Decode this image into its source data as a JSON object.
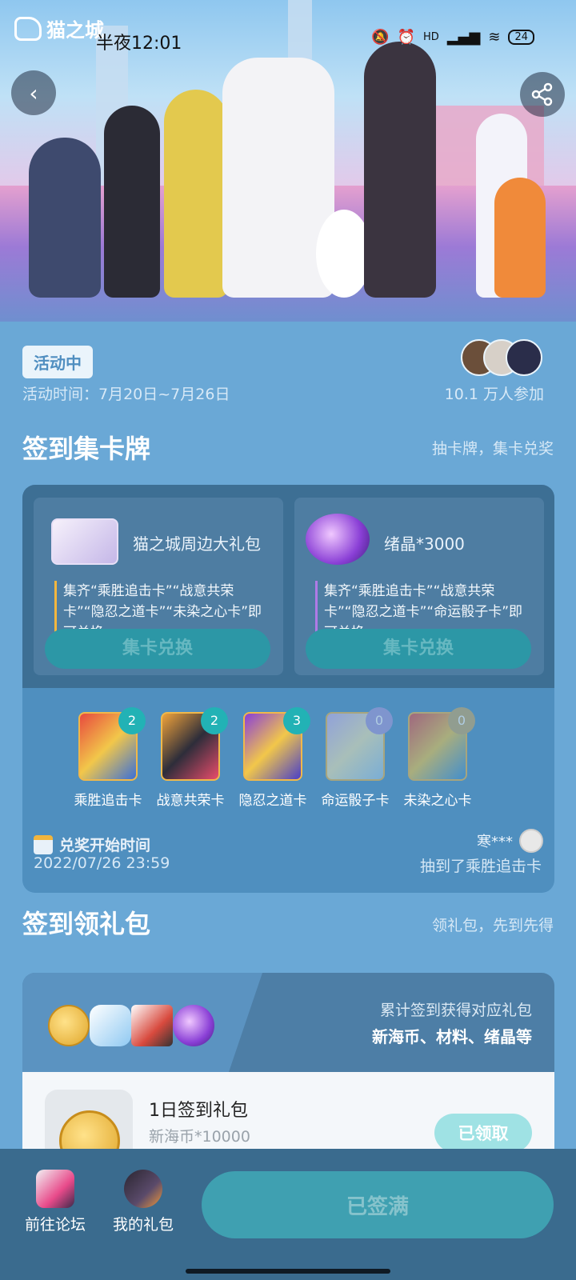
{
  "status_bar": {
    "app_logo": "猫之城",
    "time": "半夜12:01",
    "battery": "24",
    "network": "HD"
  },
  "colors": {
    "accent": "#2c97a6",
    "panel_bg": "#6aa8d6",
    "bottom_bar": "#3a6b8e",
    "badge_count": "#22b2b5"
  },
  "event": {
    "status_badge": "活动中",
    "time_range": "活动时间：7月20日~7月26日",
    "participants": "10.1 万人参加"
  },
  "checkin_cards": {
    "title": "签到集卡牌",
    "subtitle": "抽卡牌，集卡兑奖",
    "rewards": [
      {
        "title": "猫之城周边大礼包",
        "desc": "集齐“乘胜追击卡”“战意共荣卡”“隐忍之道卡”“未染之心卡”即可兑换",
        "button": "集卡兑换",
        "icon": "gift-box-icon"
      },
      {
        "title": "绪晶*3000",
        "desc": "集齐“乘胜追击卡”“战意共荣卡”“隐忍之道卡”“命运骰子卡”即可兑换",
        "button": "集卡兑换",
        "icon": "crystal-icon"
      }
    ],
    "cards": [
      {
        "label": "乘胜追击卡",
        "count": "2"
      },
      {
        "label": "战意共荣卡",
        "count": "2"
      },
      {
        "label": "隐忍之道卡",
        "count": "3"
      },
      {
        "label": "命运骰子卡",
        "count": "0"
      },
      {
        "label": "未染之心卡",
        "count": "0"
      }
    ],
    "redeem_label": "兑奖开始时间",
    "redeem_date": "2022/07/26 23:59",
    "feed_user": "寒***",
    "feed_text": "抽到了乘胜追击卡"
  },
  "checkin_gifts": {
    "title": "签到领礼包",
    "subtitle": "领礼包，先到先得",
    "desc1": "累计签到获得对应礼包",
    "desc2": "新海币、材料、绪晶等",
    "items": [
      {
        "name": "1日签到礼包",
        "amount": "新海币*10000",
        "button": "已领取"
      }
    ]
  },
  "bottom_bar": {
    "forum": "前往论坛",
    "my_gifts": "我的礼包",
    "main_button": "已签满"
  }
}
